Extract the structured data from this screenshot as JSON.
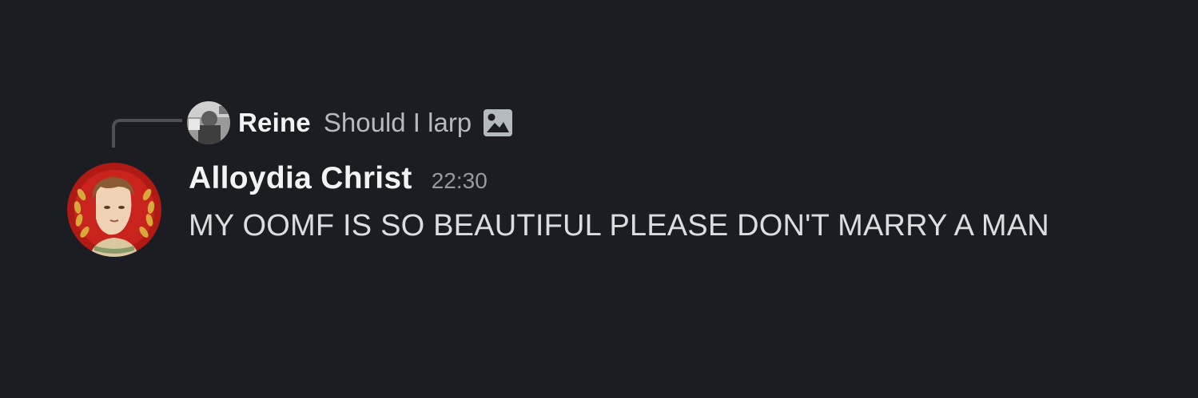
{
  "colors": {
    "background": "#1c1d22",
    "author": "#f2f3f5",
    "message_text": "#dbdee1",
    "muted_text": "#b5bac1",
    "timestamp": "#949ba4",
    "reply_spine": "#4e5058",
    "avatar_ring": "#b01a14"
  },
  "reply": {
    "author": "Reine",
    "text": "Should I larp",
    "attachment_icon": "image-icon"
  },
  "message": {
    "author": "Alloydia Christ",
    "timestamp": "22:30",
    "content": "MY OOMF IS SO BEAUTIFUL PLEASE DON'T MARRY A MAN"
  }
}
